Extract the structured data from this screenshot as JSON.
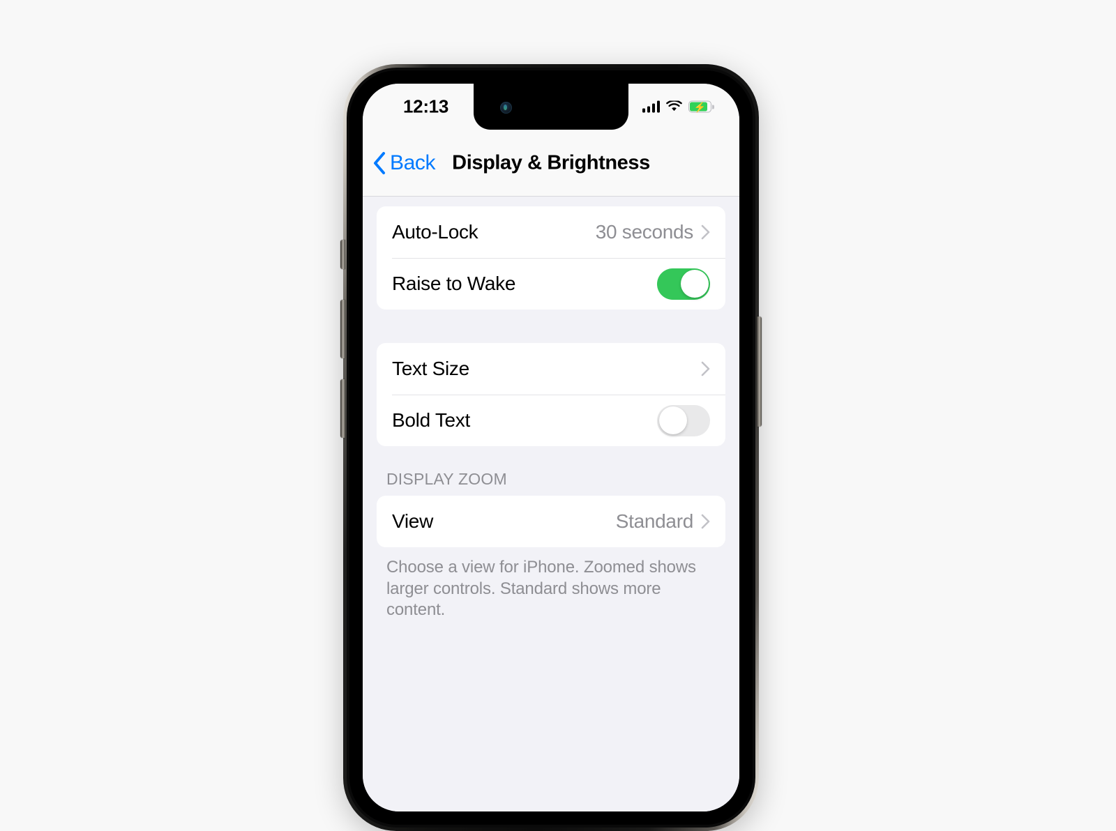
{
  "device": {
    "name": "iphone-frame",
    "side_buttons": [
      "mute-switch",
      "volume-up-button",
      "volume-down-button",
      "power-button"
    ]
  },
  "status_bar": {
    "time": "12:13",
    "cellular_icon": "signal-bars-icon",
    "cellular_bars": 4,
    "wifi_icon": "wifi-icon",
    "battery_icon": "battery-charging-icon",
    "battery_charging": true,
    "battery_color": "#31d158"
  },
  "nav_bar": {
    "back_icon": "chevron-left-icon",
    "back_label": "Back",
    "title": "Display & Brightness",
    "accent_color": "#007aff"
  },
  "sections": [
    {
      "id": "auto-lock-group",
      "header": null,
      "rows": [
        {
          "id": "auto-lock",
          "label": "Auto-Lock",
          "value": "30 seconds",
          "accessory": "chevron-right-icon"
        },
        {
          "id": "raise-to-wake",
          "label": "Raise to Wake",
          "accessory": "toggle",
          "toggle_on": true
        }
      ],
      "footer": null
    },
    {
      "id": "text-group",
      "header": null,
      "rows": [
        {
          "id": "text-size",
          "label": "Text Size",
          "value": "",
          "accessory": "chevron-right-icon"
        },
        {
          "id": "bold-text",
          "label": "Bold Text",
          "accessory": "toggle",
          "toggle_on": false
        }
      ],
      "footer": null
    },
    {
      "id": "display-zoom-group",
      "header": "DISPLAY ZOOM",
      "rows": [
        {
          "id": "view",
          "label": "View",
          "value": "Standard",
          "accessory": "chevron-right-icon"
        }
      ],
      "footer": "Choose a view for iPhone. Zoomed shows larger controls. Standard shows more content."
    }
  ],
  "colors": {
    "page_background": "#f8f8f8",
    "screen_background": "#f2f2f7",
    "card_background": "#ffffff",
    "toggle_on": "#34c759",
    "toggle_off": "#e9e9ea",
    "secondary_text": "#8e8e93",
    "accent": "#007aff"
  }
}
